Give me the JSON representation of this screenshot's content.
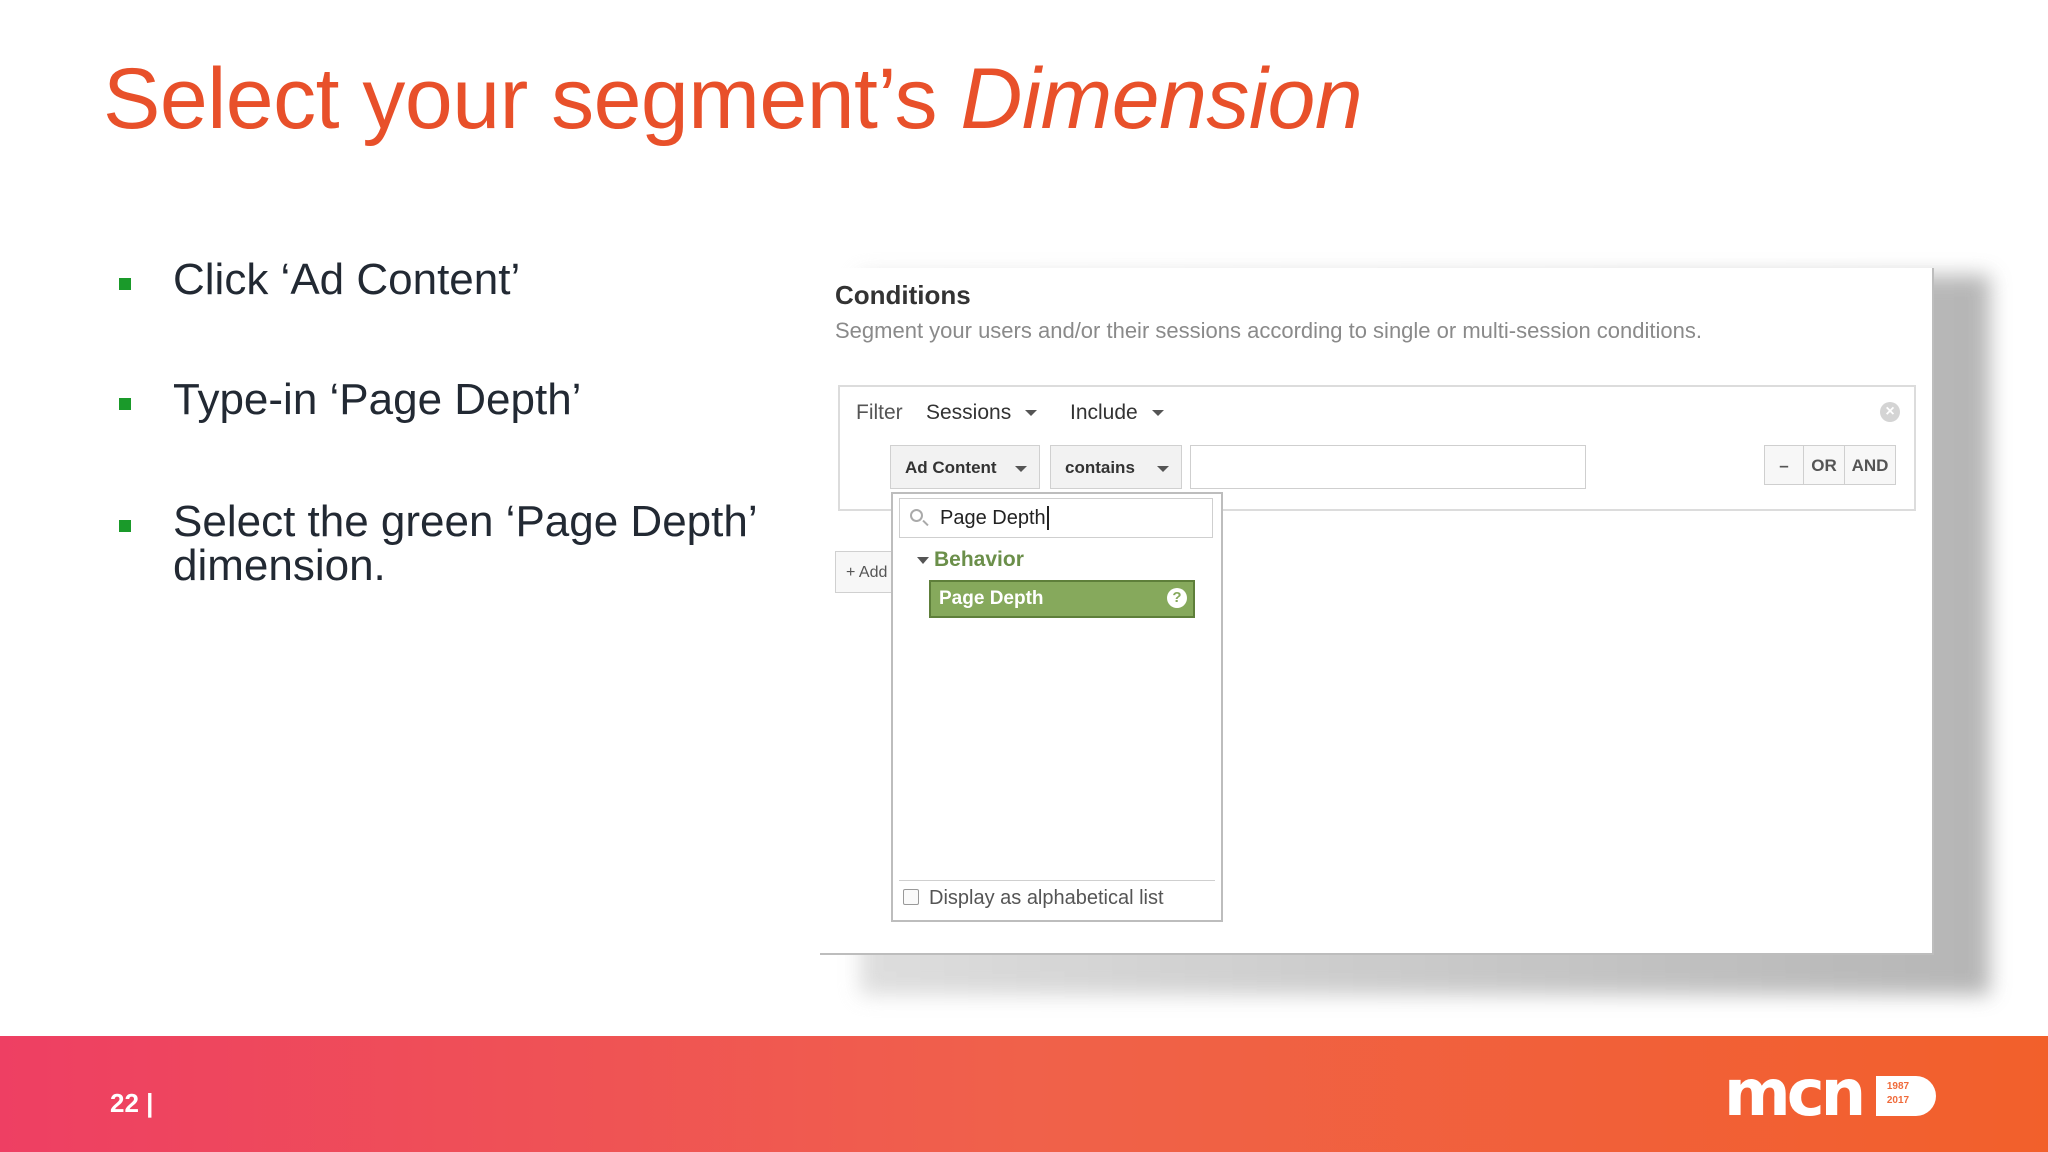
{
  "slide": {
    "title_main": "Select your segment’s",
    "title_italic": "Dimension",
    "page_number": "22 |",
    "bullets": [
      {
        "text": "Click ‘Ad Content’"
      },
      {
        "text": "Type-in ‘Page Depth’"
      },
      {
        "text": "Select the green ‘Page Depth’ dimension."
      }
    ],
    "logo": {
      "text": "mcn",
      "years_top": "1987",
      "years_bottom": "2017"
    }
  },
  "conditions": {
    "title": "Conditions",
    "description": "Segment your users and/or their sessions according to single or multi-session conditions.",
    "filter_label": "Filter",
    "scope": "Sessions",
    "mode": "Include",
    "close_icon": "x-circle-icon",
    "dimension": "Ad Content",
    "operator": "contains",
    "value": "",
    "remove_label": "–",
    "or_label": "OR",
    "and_label": "AND",
    "add_label": "+ Add"
  },
  "dropdown": {
    "search_value": "Page Depth",
    "category": "Behavior",
    "item": "Page Depth",
    "help_icon": "?",
    "alphabetical_label": "Display as alphabetical list"
  },
  "colors": {
    "title": "#e8502a",
    "bullet_mark": "#1a9a2a",
    "dimension_item": "#86a95c",
    "band_start": "#ee3f63",
    "band_end": "#f2602b"
  }
}
